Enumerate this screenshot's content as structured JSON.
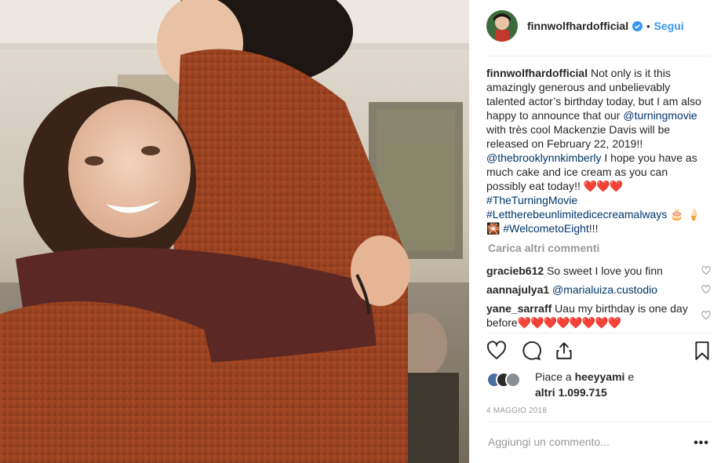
{
  "post": {
    "username": "finnwolfhardofficial",
    "follow_label": "Segui",
    "dot": "•",
    "caption": {
      "username": "finnwolfhardofficial",
      "text1": "Not only is it this amazingly generous and unbelievably talented actor’s birthday today, but I am also happy to announce that our",
      "mention1": "@turningmovie",
      "text2": "with très cool Mackenzie Davis will be released on February 22, 2019!!",
      "mention2": "@thebrooklynnkimberly",
      "text3": "I hope you have as much cake and ice cream as you can possibly eat today!!",
      "hearts": "❤️❤️❤️",
      "hashtag1": "#TheTurningMovie",
      "hashtag2": "#Lettherebeunlimitedicecreamalways",
      "emoji_cake": "🎂",
      "emoji_icecream": "🍦",
      "emoji_fireworks": "🎇",
      "hashtag3": "#WelcometoEight",
      "tail": "!!!"
    },
    "load_more_label": "Carica altri commenti",
    "comments": [
      {
        "username": "gracieb612",
        "text": "So sweet I love you finn",
        "mention": ""
      },
      {
        "username": "aannajulya1",
        "text": "",
        "mention": "@marialuiza.custodio"
      },
      {
        "username": "yane_sarraff",
        "text": "Uau my birthday is one day before",
        "hearts": "❤️❤️❤️❤️❤️❤️❤️❤️",
        "mention": ""
      }
    ],
    "likes": {
      "prefix": "Piace a",
      "liker": "heeyyami",
      "conj": "e",
      "others": "altri 1.099.715"
    },
    "date": "4 MAGGIO 2018",
    "add_comment_placeholder": "Aggiungi un commento...",
    "more_options": "•••"
  },
  "colors": {
    "link_blue": "#3897f0",
    "mention_dark": "#003569",
    "muted": "#999999",
    "heart_red": "#ed1c24"
  },
  "icons": {
    "verified": "verified-badge-icon",
    "like": "heart-outline-icon",
    "comment": "speech-bubble-icon",
    "share": "share-upload-icon",
    "save": "bookmark-icon",
    "more": "more-options-icon"
  }
}
